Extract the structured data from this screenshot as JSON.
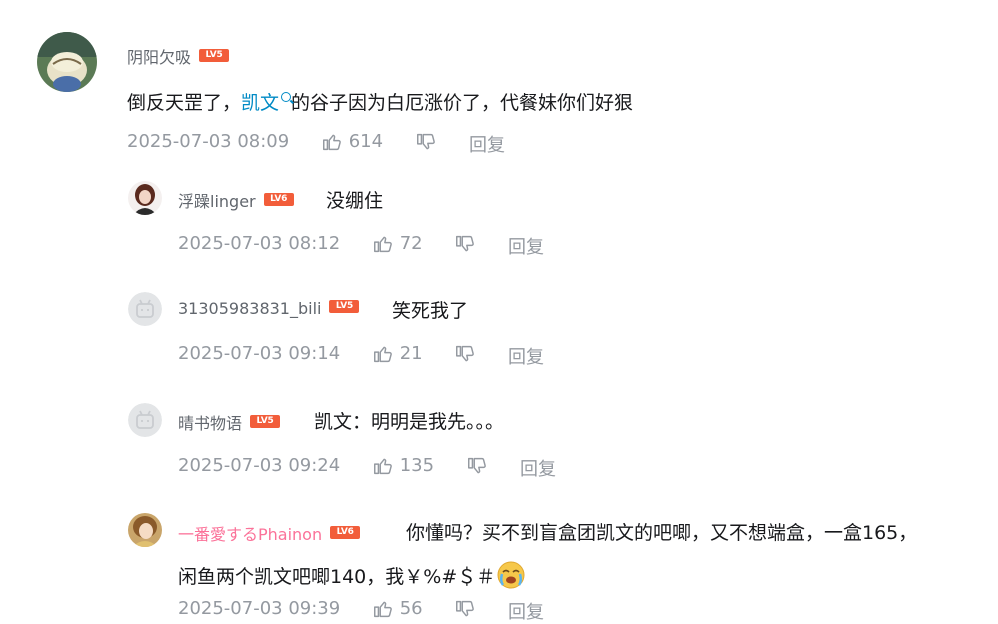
{
  "main_comment": {
    "username": "阴阳欠吸",
    "level": "LV5",
    "text_before": "倒反天罡了，",
    "link_text": "凯文",
    "text_after": "的谷子因为白厄涨价了，代餐妹你们好狠",
    "time": "2025-07-03 08:09",
    "likes": "614",
    "reply_label": "回复"
  },
  "replies": [
    {
      "username": "浮躁linger",
      "level": "LV6",
      "text": "没绷住",
      "time": "2025-07-03 08:12",
      "likes": "72",
      "reply_label": "回复"
    },
    {
      "username": "31305983831_bili",
      "level": "LV5",
      "text": "笑死我了",
      "time": "2025-07-03 09:14",
      "likes": "21",
      "reply_label": "回复"
    },
    {
      "username": "晴书物语",
      "level": "LV5",
      "text": "凯文：明明是我先。。。",
      "time": "2025-07-03 09:24",
      "likes": "135",
      "reply_label": "回复"
    },
    {
      "username": "一番愛するPhainon",
      "level": "LV6",
      "text_line1": "你懂吗？买不到盲盒团凯文的吧唧，又不想端盒，一盒165，",
      "text_line2": "闲鱼两个凯文吧唧140，我￥%#＄＃",
      "time": "2025-07-03 09:39",
      "likes": "56",
      "reply_label": "回复"
    }
  ],
  "colors": {
    "accent_link": "#008ac5",
    "level_badge": "#f25d3a",
    "vip_name": "#fb7299",
    "meta": "#9499a0"
  }
}
